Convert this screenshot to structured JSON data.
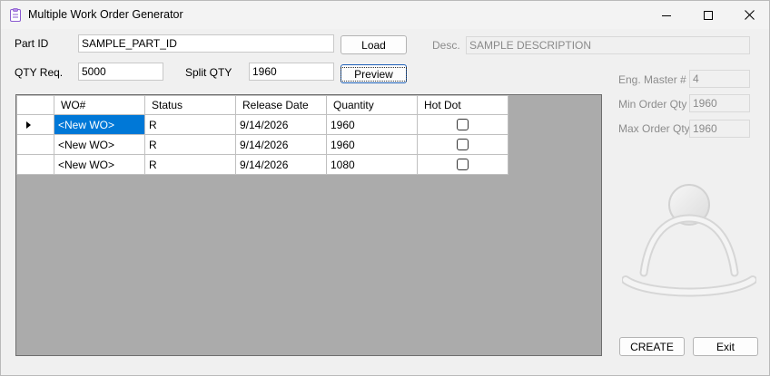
{
  "window": {
    "title": "Multiple Work Order Generator",
    "controls": [
      "minimize-icon",
      "maximize-icon",
      "close-icon"
    ]
  },
  "form": {
    "part_id_label": "Part ID",
    "part_id_value": "SAMPLE_PART_ID",
    "load_button": "Load",
    "desc_label": "Desc.",
    "desc_value": "SAMPLE DESCRIPTION",
    "qty_req_label": "QTY Req.",
    "qty_req_value": "5000",
    "split_qty_label": "Split QTY",
    "split_qty_value": "1960",
    "preview_button": "Preview"
  },
  "info": {
    "eng_master_label": "Eng. Master #",
    "eng_master_value": "4",
    "min_order_label": "Min Order Qty",
    "min_order_value": "1960",
    "max_order_label": "Max Order Qty",
    "max_order_value": "1960"
  },
  "grid": {
    "columns": [
      "WO#",
      "Status",
      "Release Date",
      "Quantity",
      "Hot Dot"
    ],
    "rows": [
      {
        "wo": "<New WO>",
        "status": "R",
        "release_date": "9/14/2026",
        "quantity": "1960",
        "hot_dot": false
      },
      {
        "wo": "<New WO>",
        "status": "R",
        "release_date": "9/14/2026",
        "quantity": "1960",
        "hot_dot": false
      },
      {
        "wo": "<New WO>",
        "status": "R",
        "release_date": "9/14/2026",
        "quantity": "1080",
        "hot_dot": false
      }
    ]
  },
  "actions": {
    "create_button": "CREATE",
    "exit_button": "Exit"
  },
  "colors": {
    "selection": "#0078d7",
    "grid_background": "#ababab",
    "focus_border": "#1b5fb8"
  }
}
